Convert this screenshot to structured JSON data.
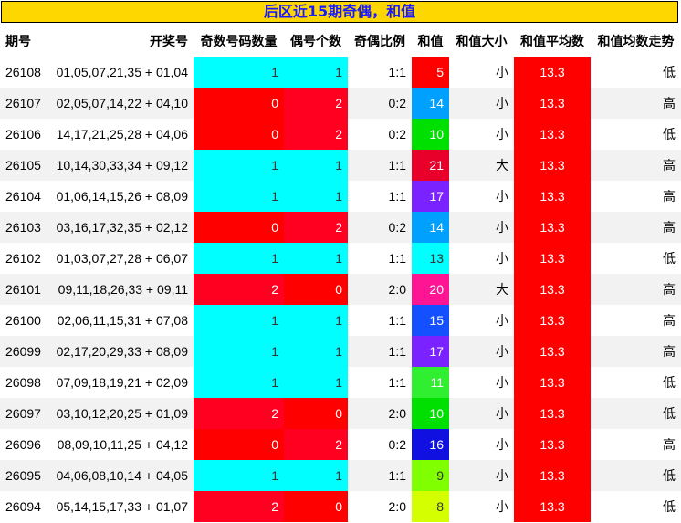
{
  "title": "后区近15期奇偶，和值",
  "headers": [
    "期号",
    "开奖号",
    "奇数号码数量",
    "偶号个数",
    "奇偶比例",
    "和值",
    "和值大小",
    "和值平均数",
    "和值均数走势"
  ],
  "colors": {
    "odd_count": {
      "0": "#ff0000",
      "1": "#00ffff",
      "2": "#ff0020"
    },
    "even_count": {
      "0": "#ff0000",
      "1": "#00ffff",
      "2": "#ff0020"
    },
    "average_bg": "#ff0000"
  },
  "rows": [
    {
      "period": "26108",
      "numbers": "01,05,07,21,35 + 01,04",
      "odd": "1",
      "even": "1",
      "ratio": "1:1",
      "sum": "5",
      "sum_color": "#ff0000",
      "size": "小",
      "avg": "13.3",
      "trend": "低"
    },
    {
      "period": "26107",
      "numbers": "02,05,07,14,22 + 04,10",
      "odd": "0",
      "even": "2",
      "ratio": "0:2",
      "sum": "14",
      "sum_color": "#00a0ff",
      "size": "小",
      "avg": "13.3",
      "trend": "高"
    },
    {
      "period": "26106",
      "numbers": "14,17,21,25,28 + 04,06",
      "odd": "0",
      "even": "2",
      "ratio": "0:2",
      "sum": "10",
      "sum_color": "#00e000",
      "size": "小",
      "avg": "13.3",
      "trend": "低"
    },
    {
      "period": "26105",
      "numbers": "10,14,30,33,34 + 09,12",
      "odd": "1",
      "even": "1",
      "ratio": "1:1",
      "sum": "21",
      "sum_color": "#e8002a",
      "size": "大",
      "avg": "13.3",
      "trend": "高"
    },
    {
      "period": "26104",
      "numbers": "01,06,14,15,26 + 08,09",
      "odd": "1",
      "even": "1",
      "ratio": "1:1",
      "sum": "17",
      "sum_color": "#7a22ff",
      "size": "小",
      "avg": "13.3",
      "trend": "高"
    },
    {
      "period": "26103",
      "numbers": "03,16,17,32,35 + 02,12",
      "odd": "0",
      "even": "2",
      "ratio": "0:2",
      "sum": "14",
      "sum_color": "#00a0ff",
      "size": "小",
      "avg": "13.3",
      "trend": "高"
    },
    {
      "period": "26102",
      "numbers": "01,03,07,27,28 + 06,07",
      "odd": "1",
      "even": "1",
      "ratio": "1:1",
      "sum": "13",
      "sum_color": "#00ffff",
      "size": "小",
      "avg": "13.3",
      "trend": "低"
    },
    {
      "period": "26101",
      "numbers": "09,11,18,26,33 + 09,11",
      "odd": "2",
      "even": "0",
      "ratio": "2:0",
      "sum": "20",
      "sum_color": "#ff1493",
      "size": "大",
      "avg": "13.3",
      "trend": "高"
    },
    {
      "period": "26100",
      "numbers": "02,06,11,15,31 + 07,08",
      "odd": "1",
      "even": "1",
      "ratio": "1:1",
      "sum": "15",
      "sum_color": "#1450ff",
      "size": "小",
      "avg": "13.3",
      "trend": "高"
    },
    {
      "period": "26099",
      "numbers": "02,17,20,29,33 + 08,09",
      "odd": "1",
      "even": "1",
      "ratio": "1:1",
      "sum": "17",
      "sum_color": "#7a22ff",
      "size": "小",
      "avg": "13.3",
      "trend": "高"
    },
    {
      "period": "26098",
      "numbers": "07,09,18,19,21 + 02,09",
      "odd": "1",
      "even": "1",
      "ratio": "1:1",
      "sum": "11",
      "sum_color": "#30ee30",
      "size": "小",
      "avg": "13.3",
      "trend": "低"
    },
    {
      "period": "26097",
      "numbers": "03,10,12,20,25 + 01,09",
      "odd": "2",
      "even": "0",
      "ratio": "2:0",
      "sum": "10",
      "sum_color": "#00e000",
      "size": "小",
      "avg": "13.3",
      "trend": "低"
    },
    {
      "period": "26096",
      "numbers": "08,09,10,11,25 + 04,12",
      "odd": "0",
      "even": "2",
      "ratio": "0:2",
      "sum": "16",
      "sum_color": "#1010e0",
      "size": "小",
      "avg": "13.3",
      "trend": "高"
    },
    {
      "period": "26095",
      "numbers": "04,06,08,10,14 + 04,05",
      "odd": "1",
      "even": "1",
      "ratio": "1:1",
      "sum": "9",
      "sum_color": "#80ff00",
      "size": "小",
      "avg": "13.3",
      "trend": "低"
    },
    {
      "period": "26094",
      "numbers": "05,14,15,17,33 + 01,07",
      "odd": "2",
      "even": "0",
      "ratio": "2:0",
      "sum": "8",
      "sum_color": "#d4ff00",
      "size": "小",
      "avg": "13.3",
      "trend": "低"
    }
  ]
}
